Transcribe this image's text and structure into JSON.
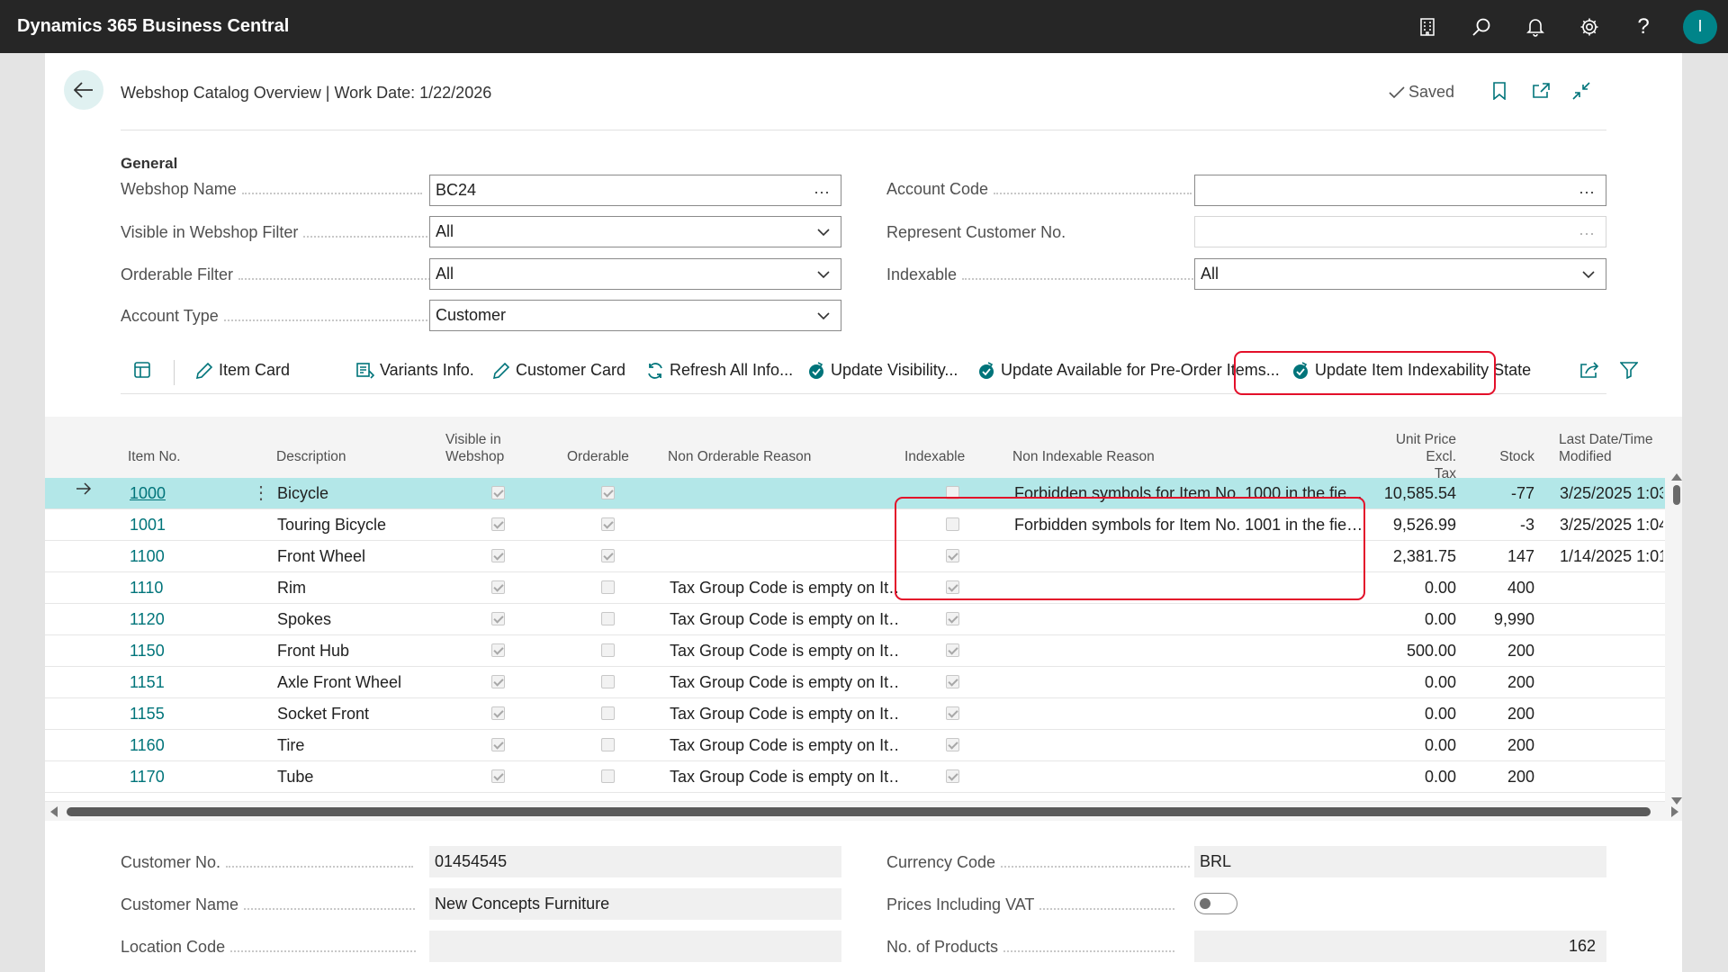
{
  "app": {
    "title": "Dynamics 365 Business Central",
    "user_initial": "I"
  },
  "header": {
    "title": "Webshop Catalog Overview | Work Date: 1/22/2026",
    "saved": "Saved"
  },
  "general": {
    "section_title": "General",
    "fields": {
      "webshop_name": {
        "label": "Webshop Name",
        "value": "BC24"
      },
      "visible_filter": {
        "label": "Visible in Webshop Filter",
        "value": "All"
      },
      "orderable_filter": {
        "label": "Orderable Filter",
        "value": "All"
      },
      "account_type": {
        "label": "Account Type",
        "value": "Customer"
      },
      "account_code": {
        "label": "Account Code",
        "value": ""
      },
      "represent_customer": {
        "label": "Represent Customer No.",
        "value": ""
      },
      "indexable": {
        "label": "Indexable",
        "value": "All"
      }
    }
  },
  "actions": [
    {
      "label": "Item Card",
      "icon": "pencil-icon"
    },
    {
      "label": "Variants Info.",
      "icon": "list-icon"
    },
    {
      "label": "Customer Card",
      "icon": "pencil-icon"
    },
    {
      "label": "Refresh All Info...",
      "icon": "refresh-icon"
    },
    {
      "label": "Update Visibility...",
      "icon": "check-process-icon"
    },
    {
      "label": "Update Available for Pre-Order Items...",
      "icon": "check-process-icon"
    },
    {
      "label": "Update Item Indexability State",
      "icon": "check-process-icon"
    }
  ],
  "grid": {
    "columns": {
      "item_no": "Item No.",
      "description": "Description",
      "visible_l1": "Visible in",
      "visible_l2": "Webshop",
      "orderable": "Orderable",
      "non_orderable_reason": "Non Orderable Reason",
      "indexable": "Indexable",
      "non_indexable_reason": "Non Indexable Reason",
      "price_l1": "Unit Price Excl.",
      "price_l2": "Tax",
      "stock": "Stock",
      "modified_l1": "Last Date/Time",
      "modified_l2": "Modified"
    },
    "rows": [
      {
        "item_no": "1000",
        "description": "Bicycle",
        "visible": true,
        "orderable": true,
        "non_orderable_reason": "",
        "indexable": false,
        "non_indexable_reason": "Forbidden symbols for Item No. 1000 in the fie…",
        "price": "10,585.54",
        "stock": "-77",
        "modified": "3/25/2025 1:03"
      },
      {
        "item_no": "1001",
        "description": "Touring Bicycle",
        "visible": true,
        "orderable": true,
        "non_orderable_reason": "",
        "indexable": false,
        "non_indexable_reason": "Forbidden symbols for Item No. 1001 in the fie…",
        "price": "9,526.99",
        "stock": "-3",
        "modified": "3/25/2025 1:04"
      },
      {
        "item_no": "1100",
        "description": "Front Wheel",
        "visible": true,
        "orderable": true,
        "non_orderable_reason": "",
        "indexable": true,
        "non_indexable_reason": "",
        "price": "2,381.75",
        "stock": "147",
        "modified": "1/14/2025 1:01"
      },
      {
        "item_no": "1110",
        "description": "Rim",
        "visible": true,
        "orderable": false,
        "non_orderable_reason": "Tax Group Code is empty on It…",
        "indexable": true,
        "non_indexable_reason": "",
        "price": "0.00",
        "stock": "400",
        "modified": ""
      },
      {
        "item_no": "1120",
        "description": "Spokes",
        "visible": true,
        "orderable": false,
        "non_orderable_reason": "Tax Group Code is empty on It…",
        "indexable": true,
        "non_indexable_reason": "",
        "price": "0.00",
        "stock": "9,990",
        "modified": ""
      },
      {
        "item_no": "1150",
        "description": "Front Hub",
        "visible": true,
        "orderable": false,
        "non_orderable_reason": "Tax Group Code is empty on It…",
        "indexable": true,
        "non_indexable_reason": "",
        "price": "500.00",
        "stock": "200",
        "modified": ""
      },
      {
        "item_no": "1151",
        "description": "Axle Front Wheel",
        "visible": true,
        "orderable": false,
        "non_orderable_reason": "Tax Group Code is empty on It…",
        "indexable": true,
        "non_indexable_reason": "",
        "price": "0.00",
        "stock": "200",
        "modified": ""
      },
      {
        "item_no": "1155",
        "description": "Socket Front",
        "visible": true,
        "orderable": false,
        "non_orderable_reason": "Tax Group Code is empty on It…",
        "indexable": true,
        "non_indexable_reason": "",
        "price": "0.00",
        "stock": "200",
        "modified": ""
      },
      {
        "item_no": "1160",
        "description": "Tire",
        "visible": true,
        "orderable": false,
        "non_orderable_reason": "Tax Group Code is empty on It…",
        "indexable": true,
        "non_indexable_reason": "",
        "price": "0.00",
        "stock": "200",
        "modified": ""
      },
      {
        "item_no": "1170",
        "description": "Tube",
        "visible": true,
        "orderable": false,
        "non_orderable_reason": "Tax Group Code is empty on It…",
        "indexable": true,
        "non_indexable_reason": "",
        "price": "0.00",
        "stock": "200",
        "modified": ""
      }
    ]
  },
  "footer": {
    "customer_no": {
      "label": "Customer No.",
      "value": "01454545"
    },
    "customer_name": {
      "label": "Customer Name",
      "value": "New Concepts Furniture"
    },
    "location_code": {
      "label": "Location Code",
      "value": ""
    },
    "currency_code": {
      "label": "Currency Code",
      "value": "BRL"
    },
    "prices_incl_vat": {
      "label": "Prices Including VAT",
      "value": false
    },
    "no_of_products": {
      "label": "No. of Products",
      "value": "162"
    }
  },
  "colors": {
    "accent": "#00747a",
    "selected_row": "#b3e7e8",
    "highlight": "#e3102a",
    "topbar": "#262626"
  }
}
